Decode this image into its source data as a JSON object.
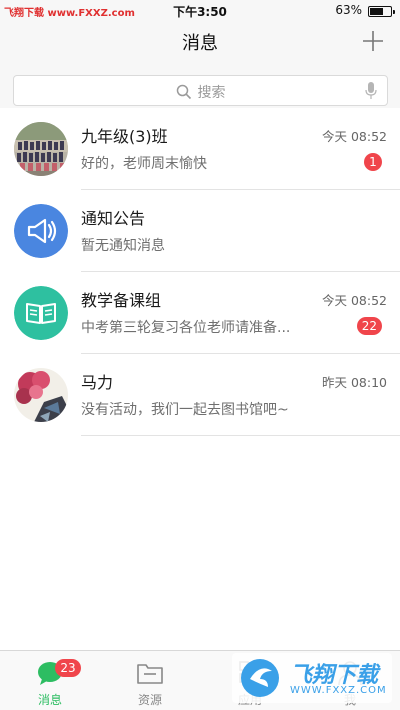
{
  "status_bar": {
    "watermark": "飞翔下载 www.FXXZ.com",
    "time": "下午3:50",
    "battery_text": "63%",
    "battery_level": 0.63
  },
  "header": {
    "title": "消息"
  },
  "search": {
    "placeholder": "搜索"
  },
  "conversations": [
    {
      "name": "九年级(3)班",
      "preview": "好的，老师周末愉快",
      "time": "今天 08:52",
      "badge": "1",
      "avatar": "class-photo"
    },
    {
      "name": "通知公告",
      "preview": "暂无通知消息",
      "time": "",
      "badge": "",
      "avatar": "megaphone-icon",
      "avatar_color": "#4a86e0"
    },
    {
      "name": "教学备课组",
      "preview": "中考第三轮复习各位老师请准备...",
      "time": "今天 08:52",
      "badge": "22",
      "avatar": "book-icon",
      "avatar_color": "#2ec0a0"
    },
    {
      "name": "马力",
      "preview": "没有活动，我们一起去图书馆吧~",
      "time": "昨天 08:10",
      "badge": "",
      "avatar": "flower-photo"
    }
  ],
  "tabbar": {
    "tabs": [
      {
        "label": "消息",
        "icon": "chat-bubble-icon",
        "badge": "23",
        "active": true
      },
      {
        "label": "资源",
        "icon": "folder-icon",
        "badge": "",
        "active": false
      },
      {
        "label": "应用",
        "icon": "apps-icon",
        "badge": "",
        "active": false
      },
      {
        "label": "我",
        "icon": "person-icon",
        "badge": "",
        "active": false
      }
    ]
  },
  "watermark_logo": {
    "text": "飞翔下载",
    "url_text": "WWW.FXXZ.COM"
  },
  "colors": {
    "accent_green": "#2dbd62",
    "badge_red": "#f0454b",
    "notice_blue": "#4a86e0",
    "group_teal": "#2ec0a0"
  }
}
